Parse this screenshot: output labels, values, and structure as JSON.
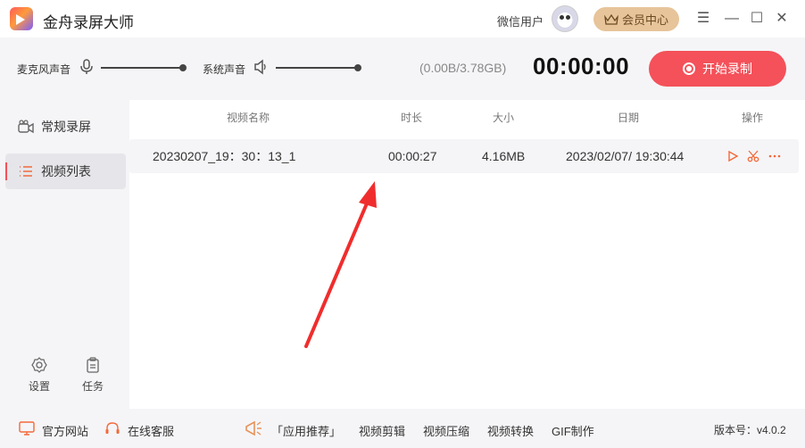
{
  "app": {
    "title": "金舟录屏大师"
  },
  "header": {
    "user_label": "微信用户",
    "member_label": "会员中心"
  },
  "controls": {
    "mic_label": "麦克风声音",
    "system_label": "系统声音",
    "storage": "(0.00B/3.78GB)",
    "timer": "00:00:00",
    "record_label": "开始录制"
  },
  "sidebar": {
    "items": [
      {
        "label": "常规录屏",
        "icon": "camera-icon"
      },
      {
        "label": "视频列表",
        "icon": "list-icon"
      }
    ],
    "settings_label": "设置",
    "tasks_label": "任务"
  },
  "table": {
    "columns": [
      "视频名称",
      "时长",
      "大小",
      "日期",
      "操作"
    ],
    "rows": [
      {
        "name": "20230207_19：30：13_1",
        "duration": "00:00:27",
        "size": "4.16MB",
        "date": "2023/02/07/ 19:30:44"
      }
    ]
  },
  "footer": {
    "website": "官方网站",
    "service": "在线客服",
    "recommend": "「应用推荐」",
    "links": [
      "视频剪辑",
      "视频压缩",
      "视频转换",
      "GIF制作"
    ],
    "version": "版本号：v4.0.2"
  },
  "colors": {
    "accent": "#f4515a",
    "member": "#e7c49a",
    "panel": "#f5f5f7"
  }
}
